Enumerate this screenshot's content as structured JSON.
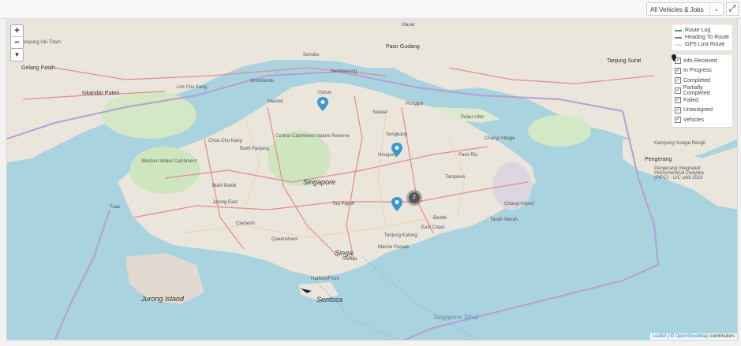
{
  "filter": {
    "selected": "All Vehicles & Jobs"
  },
  "zoom": {
    "in_label": "+",
    "out_label": "−"
  },
  "route_legend": [
    {
      "label": "Route Log",
      "color": "#4aa35a"
    },
    {
      "label": "Heading To Route",
      "color": "#9b6fd6"
    },
    {
      "label": "GPS Lost Route",
      "color": "#dddddd"
    }
  ],
  "status_legend": [
    {
      "label": "Info Received",
      "color": "#bdbdbd",
      "checked": true
    },
    {
      "label": "In Progress",
      "color": "#3f7fd1",
      "checked": true
    },
    {
      "label": "Completed",
      "color": "#3ea43e",
      "checked": true
    },
    {
      "label": "Partially Completed",
      "color": "#e99a2c",
      "checked": true
    },
    {
      "label": "Failed",
      "color": "#d93a3a",
      "checked": true
    },
    {
      "label": "Unassigned",
      "color": "#9fc3e3",
      "checked": true
    },
    {
      "label": "Vehicles",
      "color": "#222222",
      "checked": true
    }
  ],
  "cluster": {
    "count": "2"
  },
  "attribution": {
    "leaflet": "Leaflet",
    "separator": " | © ",
    "osm": "OpenStreetMap",
    "suffix": " contributors"
  },
  "map_labels": {
    "gelang_patah": "Gelang Patah",
    "iskandar_puteri": "Iskandar Puteri",
    "singapore": "Singapore",
    "sing": "Singa",
    "woodlands": "Woodlands",
    "yishun": "Yishun",
    "seletar": "Seletar",
    "sengkang": "Sengkang",
    "punggol": "Punggol",
    "hougang": "Hougang",
    "tampines": "Tampines",
    "changi_village": "Changi Village",
    "changi_airport": "Changi Airport",
    "pasir_gudang": "Pasir Gudang",
    "tanjung_surat": "Tanjung Surat",
    "pengerang": "Pengerang",
    "kampung_sungai_rengit": "Kampung Sungai Rengit",
    "bukit_panjang": "Bukit Panjang",
    "bukit_batok": "Bukit Batok",
    "jurong_island": "Jurong Island",
    "sentosa": "Sentosa",
    "singapore_strait": "Singapore Strait",
    "east_coast": "East Coast",
    "bedok": "Bedok",
    "queenstown": "Queenstown",
    "central_catchment": "Central Catchment Nature Reserve",
    "western_water": "Western Water Catchment",
    "tuas": "Tuas",
    "ulu_tiram": "Kampung Ulu Tiram",
    "masai": "Masai",
    "senoko": "Senoko",
    "mandai": "Mandai",
    "sembawang": "Sembawang",
    "lim_chu_kang": "Lim Chu Kang",
    "choa_chu_kang": "Choa Chu Kang",
    "pasir_ris": "Pasir Ris",
    "toa_payoh": "Toa Payoh",
    "katong": "Tanjong Katong",
    "tanah_merah": "Tanah Merah",
    "pulau_ubin": "Pulau Ubin",
    "pengerang_complex": "Pengerang Integrated Petrochemical Complex (PIPC) - U/C until 2019",
    "harbourfront": "HarbourFront",
    "raffles": "Raffles",
    "marine_parade": "Marine Parade",
    "jurong_east": "Jurong East",
    "clementi": "Clementi"
  }
}
